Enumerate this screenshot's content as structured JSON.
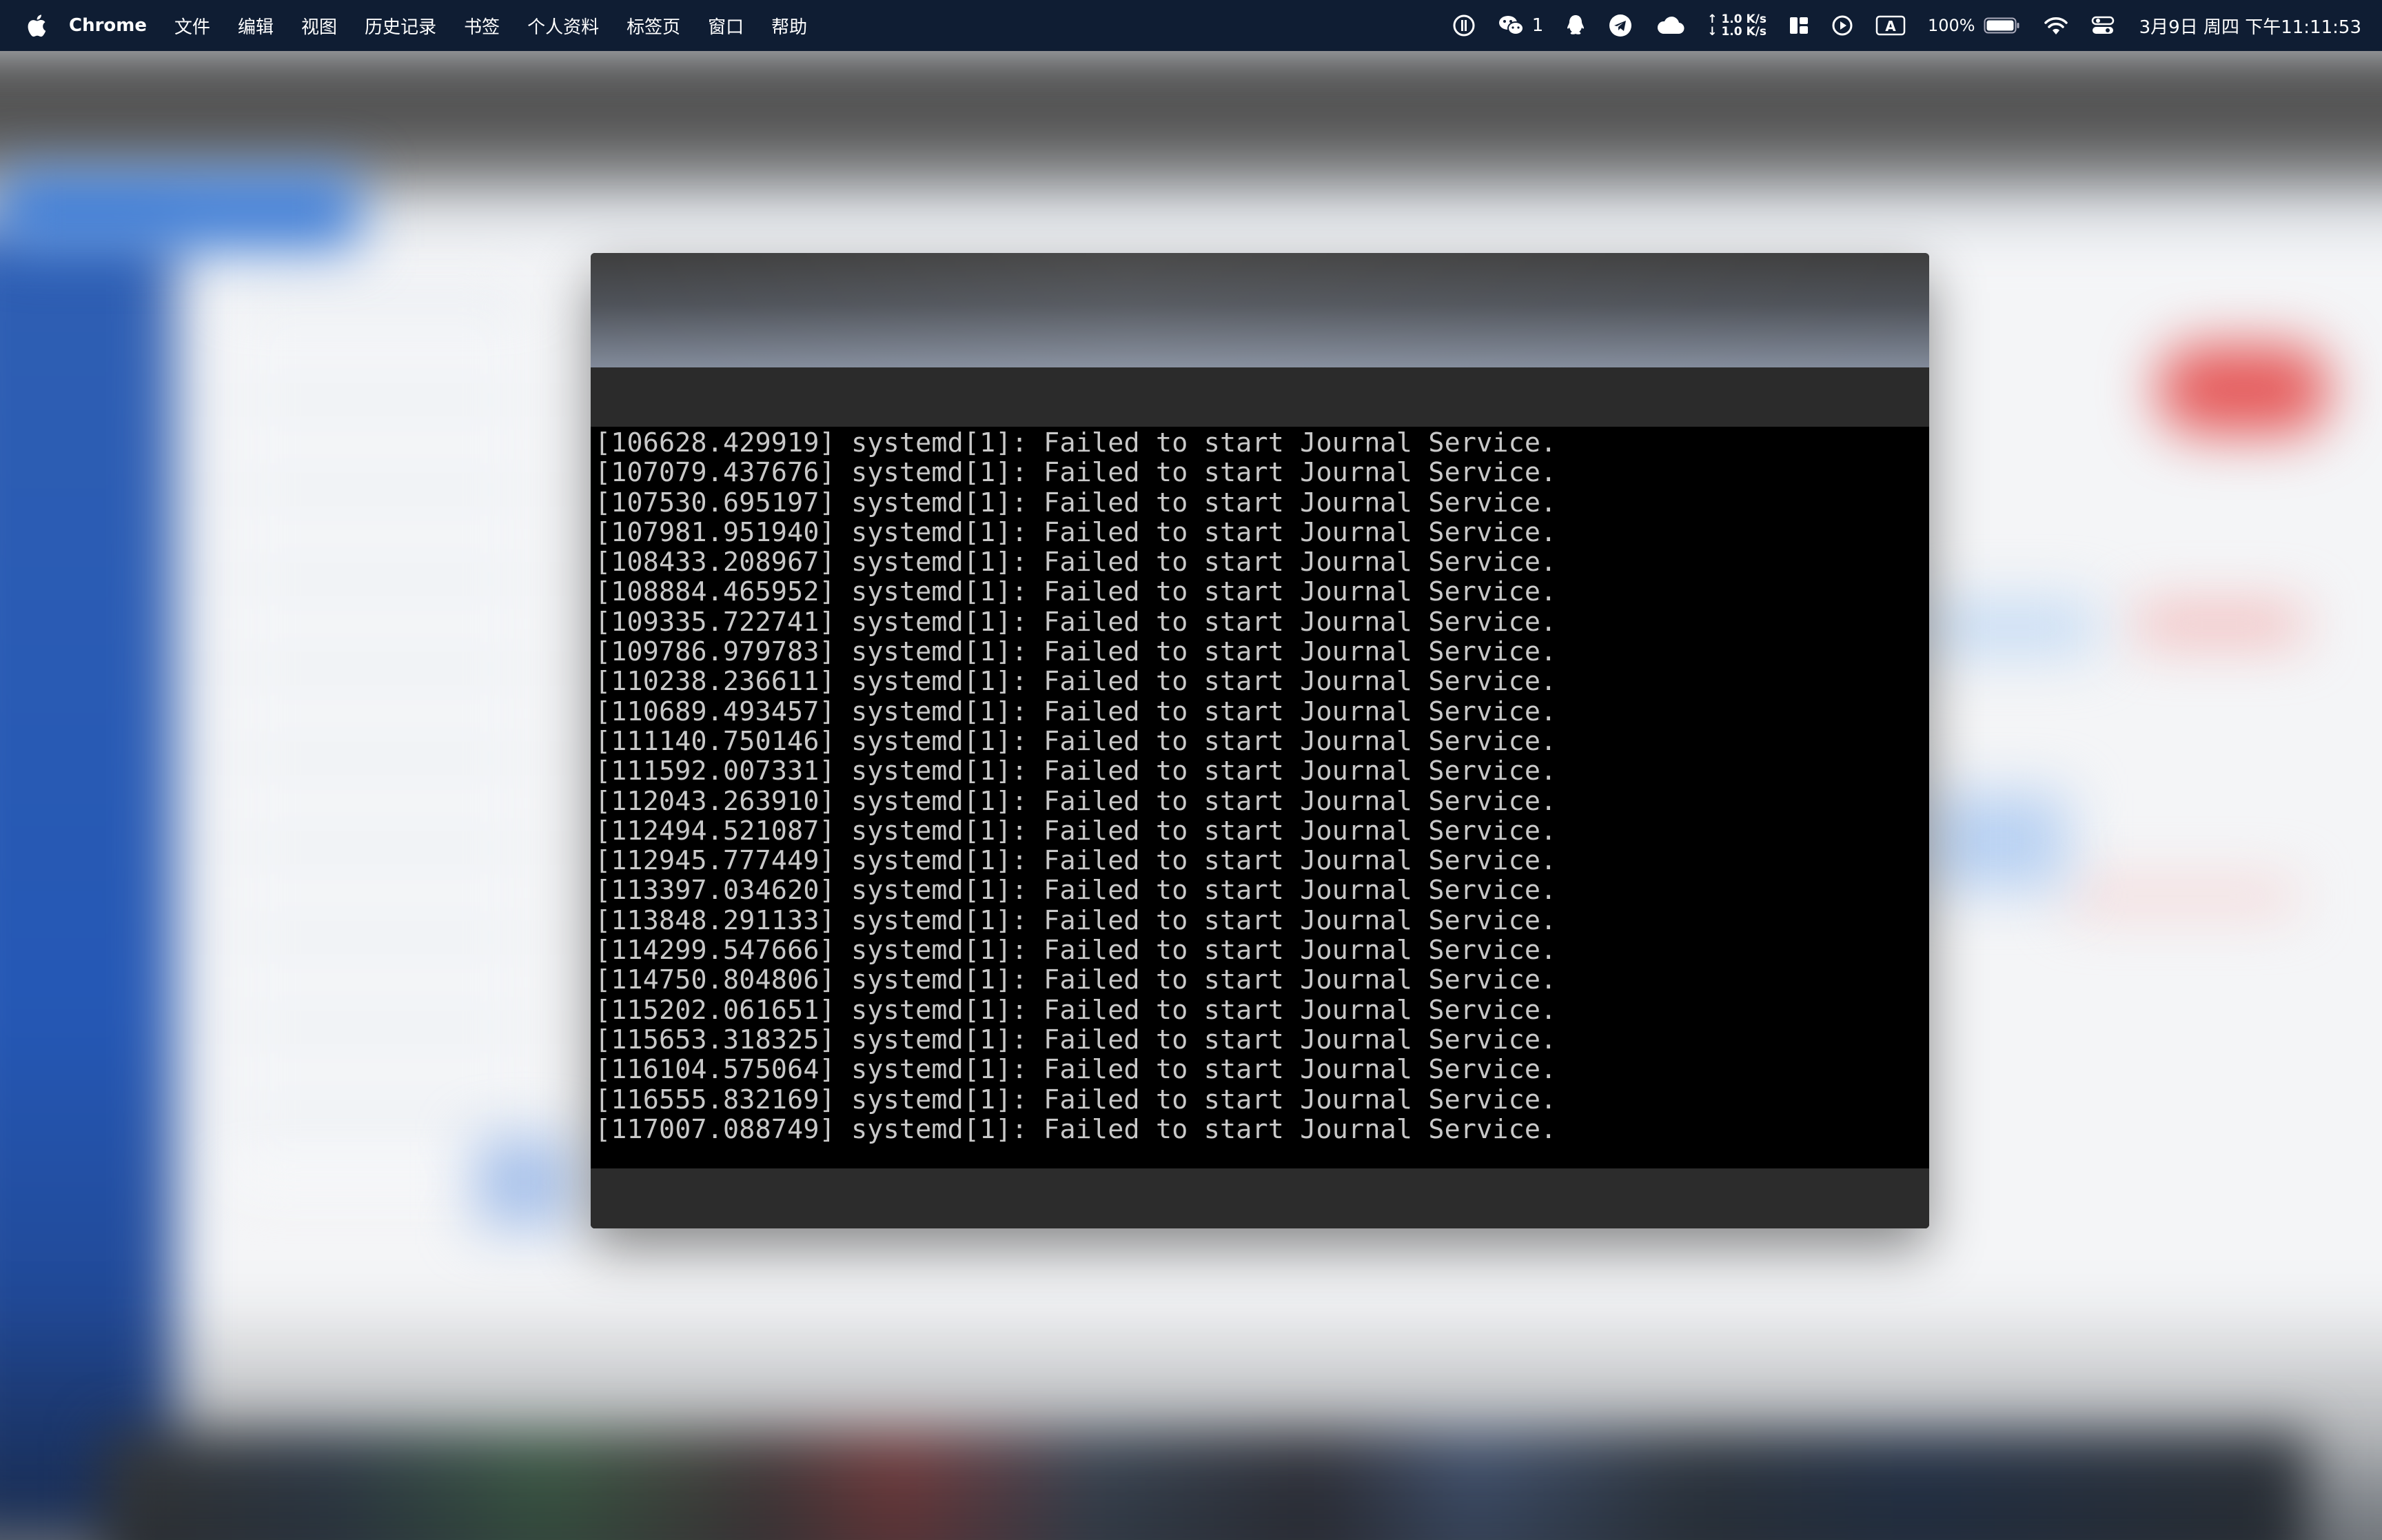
{
  "menubar": {
    "app_name": "Chrome",
    "menu_items": [
      "文件",
      "编辑",
      "视图",
      "历史记录",
      "书签",
      "个人资料",
      "标签页",
      "窗口",
      "帮助"
    ],
    "wechat_count": "1",
    "net_up": "↑ 1.0 K/s",
    "net_down": "↓ 1.0 K/s",
    "input_method": "A",
    "battery_percent": "100%",
    "clock": "3月9日 周四  下午11:11:53"
  },
  "console": {
    "lines": [
      "[106628.429919] systemd[1]: Failed to start Journal Service.",
      "[107079.437676] systemd[1]: Failed to start Journal Service.",
      "[107530.695197] systemd[1]: Failed to start Journal Service.",
      "[107981.951940] systemd[1]: Failed to start Journal Service.",
      "[108433.208967] systemd[1]: Failed to start Journal Service.",
      "[108884.465952] systemd[1]: Failed to start Journal Service.",
      "[109335.722741] systemd[1]: Failed to start Journal Service.",
      "[109786.979783] systemd[1]: Failed to start Journal Service.",
      "[110238.236611] systemd[1]: Failed to start Journal Service.",
      "[110689.493457] systemd[1]: Failed to start Journal Service.",
      "[111140.750146] systemd[1]: Failed to start Journal Service.",
      "[111592.007331] systemd[1]: Failed to start Journal Service.",
      "[112043.263910] systemd[1]: Failed to start Journal Service.",
      "[112494.521087] systemd[1]: Failed to start Journal Service.",
      "[112945.777449] systemd[1]: Failed to start Journal Service.",
      "[113397.034620] systemd[1]: Failed to start Journal Service.",
      "[113848.291133] systemd[1]: Failed to start Journal Service.",
      "[114299.547666] systemd[1]: Failed to start Journal Service.",
      "[114750.804806] systemd[1]: Failed to start Journal Service.",
      "[115202.061651] systemd[1]: Failed to start Journal Service.",
      "[115653.318325] systemd[1]: Failed to start Journal Service.",
      "[116104.575064] systemd[1]: Failed to start Journal Service.",
      "[116555.832169] systemd[1]: Failed to start Journal Service.",
      "[117007.088749] systemd[1]: Failed to start Journal Service."
    ]
  },
  "colors": {
    "menubar_bg": "#0f1d33",
    "console_bg": "#000000",
    "console_text": "#c9c9c9"
  }
}
